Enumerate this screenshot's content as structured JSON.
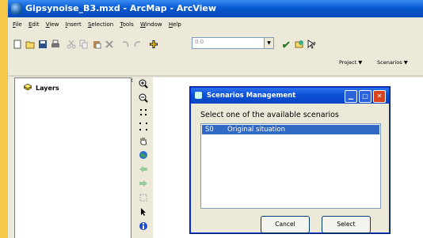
{
  "window": {
    "title": "Gipsynoise_B3.mxd - ArcMap - ArcView"
  },
  "menu": [
    "File",
    "Edit",
    "View",
    "Insert",
    "Selection",
    "Tools",
    "Window",
    "Help"
  ],
  "toolbar": {
    "scale_value": "0.0"
  },
  "toolbar2": {
    "project_label": "Project ▼",
    "scenarios_label": "Scenarios ▼"
  },
  "toc": {
    "layers_label": "Layers",
    "close_glyph": "×"
  },
  "dialog": {
    "title": "Scenarios Management",
    "prompt": "Select one of the available scenarios",
    "items": [
      {
        "code": "S0",
        "description": "Original situation"
      }
    ],
    "cancel_label": "Cancel",
    "select_label": "Select"
  }
}
